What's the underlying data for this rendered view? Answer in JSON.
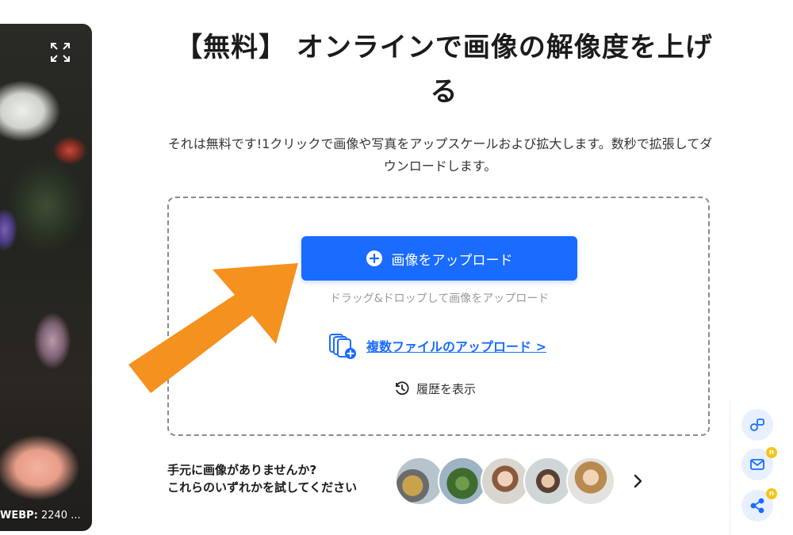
{
  "preview": {
    "caption_format": "WEBP:",
    "caption_size": " 2240 ..."
  },
  "hero": {
    "title": "【無料】 オンラインで画像の解像度を上げる",
    "subtitle": "それは無料です!1クリックで画像や写真をアップスケールおよび拡大します。数秒で拡張してダウンロードします。"
  },
  "upload": {
    "button_label": "画像をアップロード",
    "drag_hint": "ドラッグ&ドロップして画像をアップロード",
    "multi_link": "複数ファイルのアップロード >",
    "history": "履歴を表示"
  },
  "samples": {
    "prompt_line1": "手元に画像がありませんか?",
    "prompt_line2": "これらのいずれかを試してください"
  },
  "floating": {
    "mail_badge": "n",
    "share_badge": "n"
  },
  "colors": {
    "primary": "#1a6bff",
    "annotation_arrow": "#f5911e",
    "badge": "#f5c518"
  }
}
